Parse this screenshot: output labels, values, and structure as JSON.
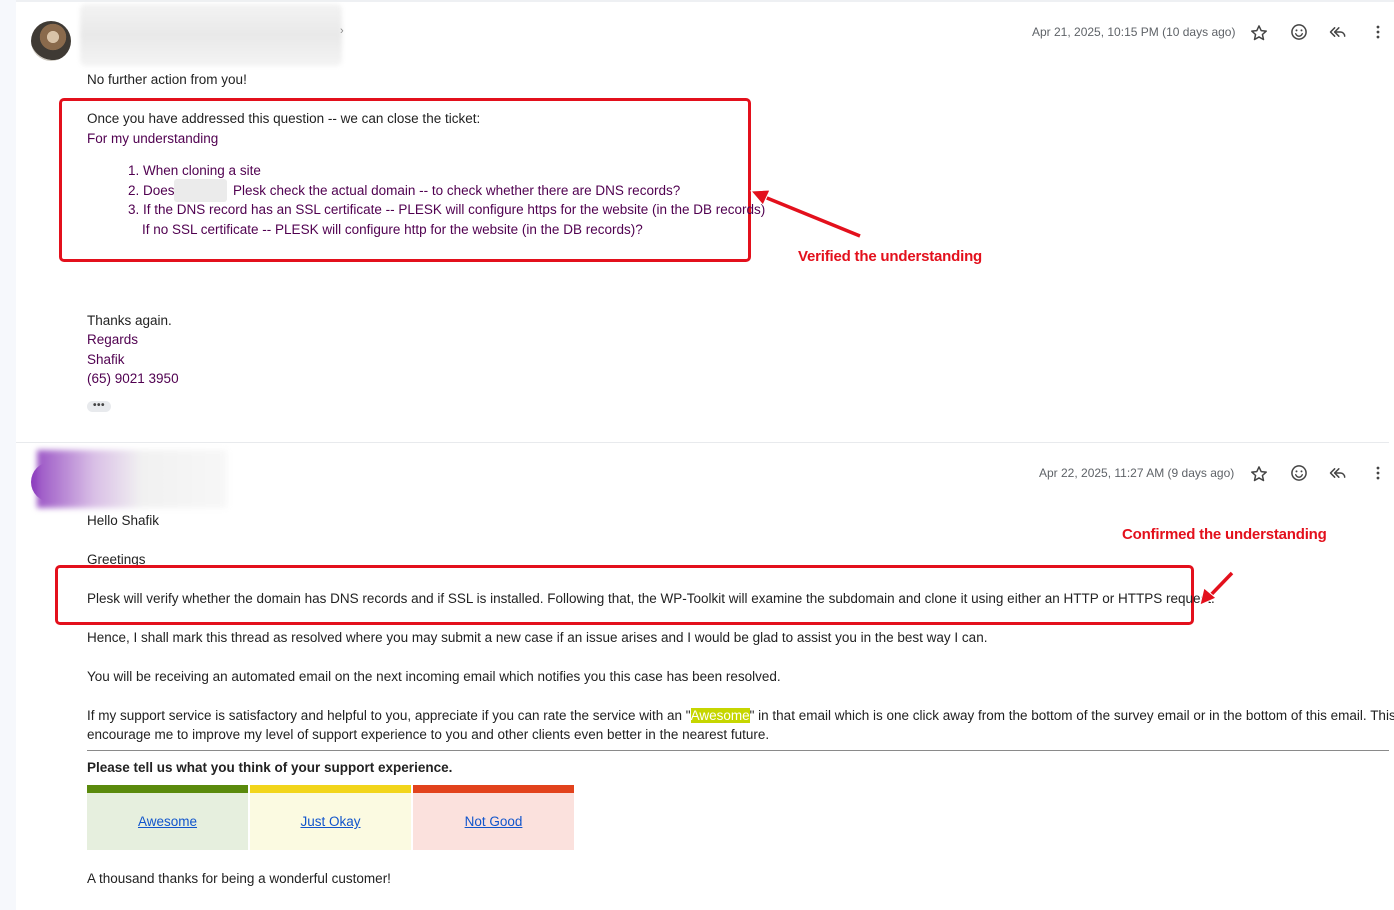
{
  "message1": {
    "date": "Apr 21, 2025, 10:15 PM (10 days ago)",
    "sender_chevron": "›",
    "line_no_action": "No further action from you!",
    "intro": "Once you have addressed this question -- we can close the ticket:",
    "for_understanding": "For my understanding",
    "item1": "1. When cloning a site",
    "item2_pre": "2. Does",
    "item2_post": "Plesk check the actual domain -- to check whether there are DNS records?",
    "item3": "3. If the DNS record has an SSL certificate -- PLESK will configure https for the website (in the DB records)",
    "item3_cont": "If no SSL certificate -- PLESK will configure http for the website (in the DB records)?",
    "thanks": "Thanks again.",
    "regards": "Regards",
    "name": "Shafik",
    "phone": "(65) 9021 3950",
    "ellipsis": "•••",
    "annotation": "Verified the understanding"
  },
  "message2": {
    "date": "Apr 22, 2025, 11:27 AM (9 days ago)",
    "greeting": "Hello Shafik",
    "greetings2": "Greetings",
    "verify_line": "Plesk will verify whether the domain has DNS records and if SSL is installed. Following that, the WP-Toolkit will examine the subdomain and clone it using either an HTTP or HTTPS request.",
    "resolved_line": "Hence, I shall mark this thread as resolved where you may submit a new case if an issue arises and I would be glad to assist you in the best way I can.",
    "auto_email_line": "You will be receiving an automated email on the next incoming email which notifies you this case has been resolved.",
    "rate_pre": "If my support service is satisfactory and helpful to you, appreciate if you can rate the service with an \"",
    "rate_highlight": "Awesome",
    "rate_post": "\" in that email which is one click away from the bottom of the survey email or in the bottom of this email. This will",
    "rate_line2": "encourage me to improve my level of support experience to you and other clients even better in the nearest future.",
    "survey_title": "Please tell us what you think of your support experience.",
    "survey": [
      {
        "label": "Awesome",
        "bar": "#5a8a0c",
        "bg": "#e6efde"
      },
      {
        "label": "Just Okay",
        "bar": "#f2d51b",
        "bg": "#fbfae1"
      },
      {
        "label": "Not Good",
        "bar": "#e2421c",
        "bg": "#fbe1dd"
      }
    ],
    "closing": "A thousand thanks for being a wonderful customer!",
    "annotation": "Confirmed the understanding"
  },
  "icons": [
    "star-icon",
    "emoji-icon",
    "reply-all-icon",
    "more-vert-icon"
  ]
}
